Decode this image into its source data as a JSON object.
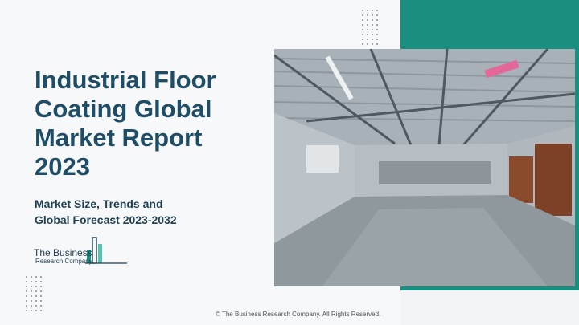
{
  "slide": {
    "title_lines": [
      "Industrial Floor",
      "Coating Global",
      "Market Report",
      "2023"
    ],
    "subtitle_lines": [
      "Market Size, Trends and",
      "Global Forecast 2023-2032"
    ],
    "logo": {
      "line1": "The Business",
      "line2": "Research Company"
    },
    "footer": "© The Business Research Company. All Rights Reserved.",
    "photo_description": "empty-warehouse-icon",
    "colors": {
      "accent_teal": "#1a8e7f",
      "title_blue": "#1f4d66"
    }
  }
}
